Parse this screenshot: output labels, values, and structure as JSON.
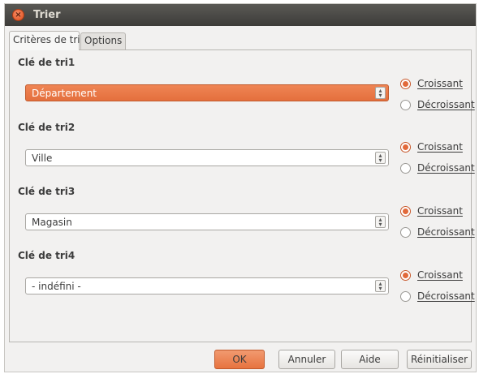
{
  "window": {
    "title": "Trier"
  },
  "tabs": [
    {
      "label": "Critères de tri"
    },
    {
      "label": "Options"
    }
  ],
  "sort_keys": [
    {
      "label": "Clé de tri1",
      "value": "Département",
      "ascending": "Croissant",
      "descending": "Décroissant",
      "selected_order": "Croissant",
      "highlighted": true
    },
    {
      "label": "Clé de tri2",
      "value": "Ville",
      "ascending": "Croissant",
      "descending": "Décroissant",
      "selected_order": "Croissant",
      "highlighted": false
    },
    {
      "label": "Clé de tri3",
      "value": "Magasin",
      "ascending": "Croissant",
      "descending": "Décroissant",
      "selected_order": "Croissant",
      "highlighted": false
    },
    {
      "label": "Clé de tri4",
      "value": "- indéfini -",
      "ascending": "Croissant",
      "descending": "Décroissant",
      "selected_order": "Croissant",
      "highlighted": false
    }
  ],
  "buttons": {
    "ok": "OK",
    "cancel": "Annuler",
    "help": "Aide",
    "reset": "Réinitialiser"
  },
  "colors": {
    "accent": "#e46f3d",
    "titlebar": "#3d3c39",
    "close": "#df4f1e"
  },
  "icons": {
    "close": "close-icon",
    "spin": "spin-arrows-icon"
  }
}
